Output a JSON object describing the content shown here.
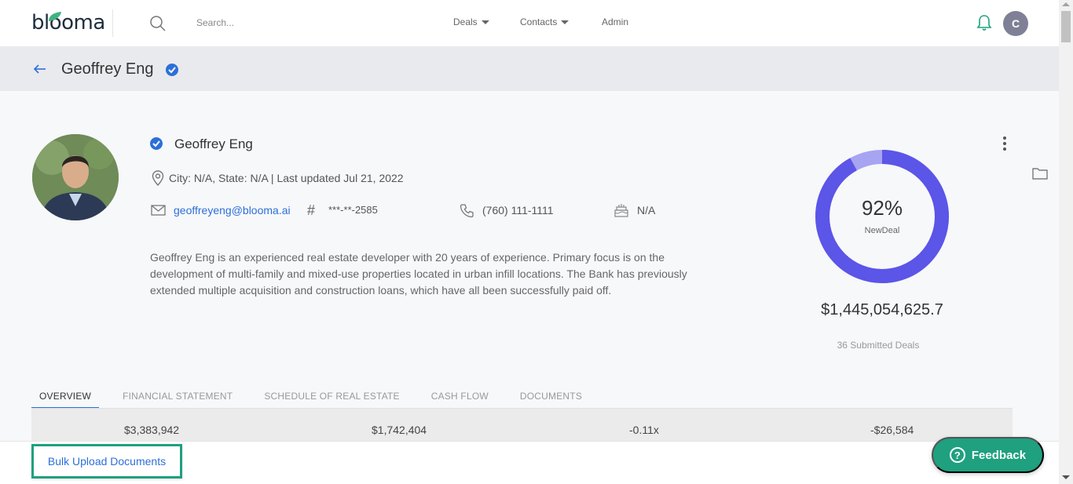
{
  "header": {
    "logo_text": "blooma",
    "search_placeholder": "Search...",
    "nav": [
      {
        "label": "Deals",
        "has_dropdown": true
      },
      {
        "label": "Contacts",
        "has_dropdown": true
      },
      {
        "label": "Admin",
        "has_dropdown": false
      }
    ],
    "user_initial": "C",
    "bell_icon": "bell-icon",
    "accent_color": "#1fa07f"
  },
  "page": {
    "title": "Geoffrey Eng",
    "verified_icon": "verified-check-icon"
  },
  "profile": {
    "name": "Geoffrey Eng",
    "location": "City: N/A, State: N/A | Last updated Jul 21, 2022",
    "email": "geoffreyeng@blooma.ai",
    "ssn": "***-**-2585",
    "phone": "(760) 111-1111",
    "dob": "N/A",
    "bio": "Geoffrey Eng is an experienced real estate developer with 20 years of experience. Primary focus is on the development of multi-family and mixed-use properties located in urban infill locations. The Bank has previously extended multiple acquisition and construction loans, which have all been successfully paid off."
  },
  "score": {
    "percent": 92,
    "percent_label": "92%",
    "label": "NewDeal",
    "amount": "$1,445,054,625.7",
    "submitted": "36 Submitted Deals",
    "ring_color": "#5b55e8",
    "ring_remainder_color": "#a7a4f2"
  },
  "tabs": [
    {
      "label": "OVERVIEW",
      "active": true
    },
    {
      "label": "FINANCIAL STATEMENT",
      "active": false
    },
    {
      "label": "SCHEDULE OF REAL ESTATE",
      "active": false
    },
    {
      "label": "CASH FLOW",
      "active": false
    },
    {
      "label": "DOCUMENTS",
      "active": false
    }
  ],
  "summary": [
    "$3,383,942",
    "$1,742,404",
    "-0.11x",
    "-$26,584"
  ],
  "actions": {
    "bulk_upload": "Bulk Upload Documents",
    "feedback": "Feedback"
  }
}
